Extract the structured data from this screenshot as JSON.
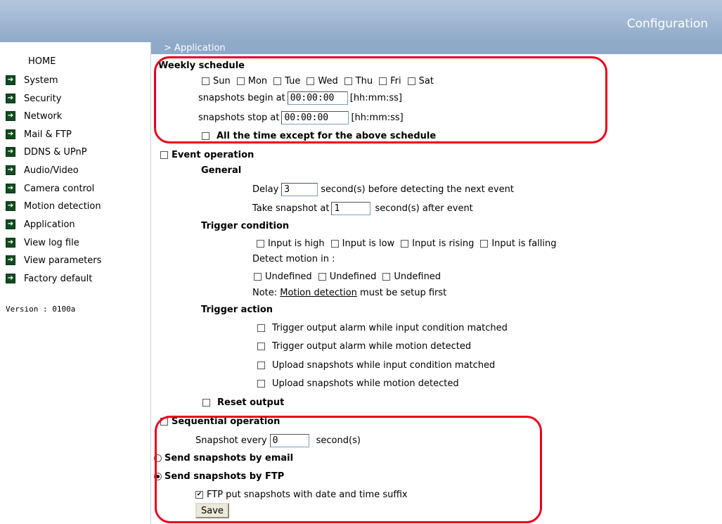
{
  "header": {
    "title": "Configuration"
  },
  "breadcrumb": "> Application",
  "sidebar": {
    "home": "HOME",
    "items": [
      {
        "label": "System"
      },
      {
        "label": "Security"
      },
      {
        "label": "Network"
      },
      {
        "label": "Mail & FTP"
      },
      {
        "label": "DDNS & UPnP"
      },
      {
        "label": "Audio/Video"
      },
      {
        "label": "Camera control"
      },
      {
        "label": "Motion detection"
      },
      {
        "label": "Application"
      },
      {
        "label": "View log file"
      },
      {
        "label": "View parameters"
      },
      {
        "label": "Factory default"
      }
    ],
    "version": "Version : 0100a"
  },
  "weekly": {
    "title": "Weekly schedule",
    "days": [
      "Sun",
      "Mon",
      "Tue",
      "Wed",
      "Thu",
      "Fri",
      "Sat"
    ],
    "begin_label": "snapshots begin at",
    "begin_value": "00:00:00",
    "stop_label": "snapshots stop at",
    "stop_value": "00:00:00",
    "format": "[hh:mm:ss]",
    "except_label": "All the time except for the above schedule"
  },
  "event": {
    "title": "Event operation",
    "general": {
      "title": "General",
      "delay_label": "Delay",
      "delay_value": "3",
      "delay_suffix": "second(s) before detecting the next event",
      "snapshot_label": "Take snapshot at",
      "snapshot_value": "1",
      "snapshot_suffix": "second(s) after event"
    },
    "trigger_condition": {
      "title": "Trigger condition",
      "inputs": [
        "Input is high",
        "Input is low",
        "Input is rising",
        "Input is falling"
      ],
      "detect_label": "Detect motion in :",
      "motion": [
        "Undefined",
        "Undefined",
        "Undefined"
      ],
      "note_prefix": "Note:",
      "note_link": "Motion detection",
      "note_suffix": "must be setup first"
    },
    "trigger_action": {
      "title": "Trigger action",
      "items": [
        "Trigger output alarm while input condition matched",
        "Trigger output alarm while motion detected",
        "Upload snapshots while input condition matched",
        "Upload snapshots while motion detected"
      ]
    },
    "reset_label": "Reset output"
  },
  "sequential": {
    "title": "Sequential operation",
    "every_label": "Snapshot every",
    "every_value": "0",
    "every_suffix": "second(s)"
  },
  "send": {
    "email_label": "Send snapshots by email",
    "ftp_label": "Send snapshots by FTP",
    "selected": "ftp",
    "suffix_label": "FTP put snapshots with date and time suffix",
    "suffix_checked": true
  },
  "save_label": "Save",
  "colors": {
    "header": "#8fa9c8",
    "highlight": "#e8001c",
    "nav_icon": "#0e4c1f"
  }
}
